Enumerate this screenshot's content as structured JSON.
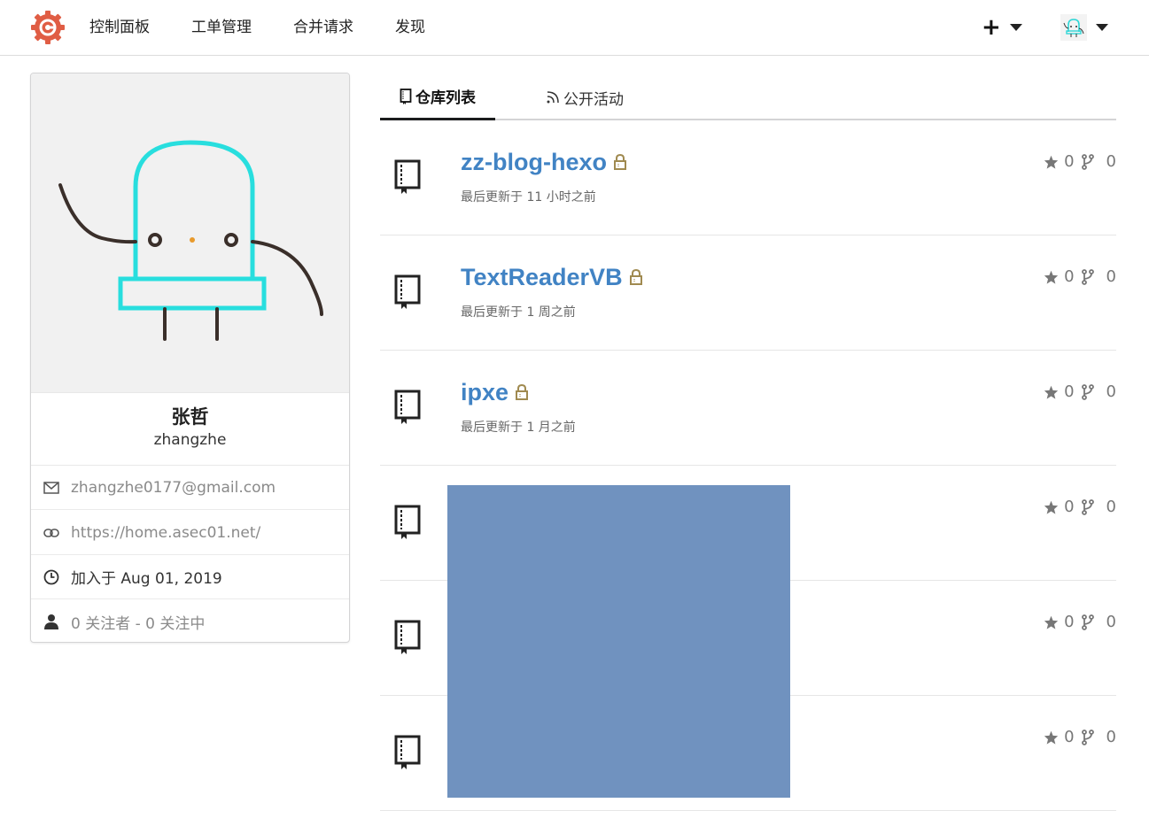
{
  "nav": {
    "items": [
      "控制面板",
      "工单管理",
      "合并请求",
      "发现"
    ],
    "plus_label": "+"
  },
  "profile": {
    "full_name": "张哲",
    "username": "zhangzhe",
    "email": "zhangzhe0177@gmail.com",
    "website": "https://home.asec01.net/",
    "joined": "加入于 Aug 01, 2019",
    "follow": "0 关注者 - 0 关注中"
  },
  "tabs": [
    {
      "label": "仓库列表",
      "active": true
    },
    {
      "label": "公开活动",
      "active": false
    }
  ],
  "repos": [
    {
      "name": "zz-blog-hexo",
      "updated": "最后更新于 11 小时之前",
      "stars": "0",
      "forks": "0",
      "private": true
    },
    {
      "name": "TextReaderVB",
      "updated": "最后更新于 1 周之前",
      "stars": "0",
      "forks": "0",
      "private": true
    },
    {
      "name": "ipxe",
      "updated": "最后更新于 1 月之前",
      "stars": "0",
      "forks": "0",
      "private": true
    },
    {
      "name": "",
      "updated": "",
      "stars": "0",
      "forks": "0",
      "private": false
    },
    {
      "name": "",
      "updated": "",
      "stars": "0",
      "forks": "0",
      "private": false
    },
    {
      "name": "",
      "updated": "",
      "stars": "0",
      "forks": "0",
      "private": false
    }
  ],
  "colors": {
    "link": "#4183c4",
    "redaction": "#7092bf",
    "logo": "#e05d44",
    "lock": "#a08a50",
    "avatar_bg": "#f1f1f1"
  },
  "icons": {
    "logo": "gitea-logo-icon",
    "avatar_small": "robot-avatar-icon",
    "mail": "mail-icon",
    "link": "link-icon",
    "clock": "clock-icon",
    "user": "user-icon",
    "book": "book-icon",
    "rss": "rss-icon",
    "lock": "lock-icon",
    "star": "star-icon",
    "fork": "fork-icon"
  }
}
